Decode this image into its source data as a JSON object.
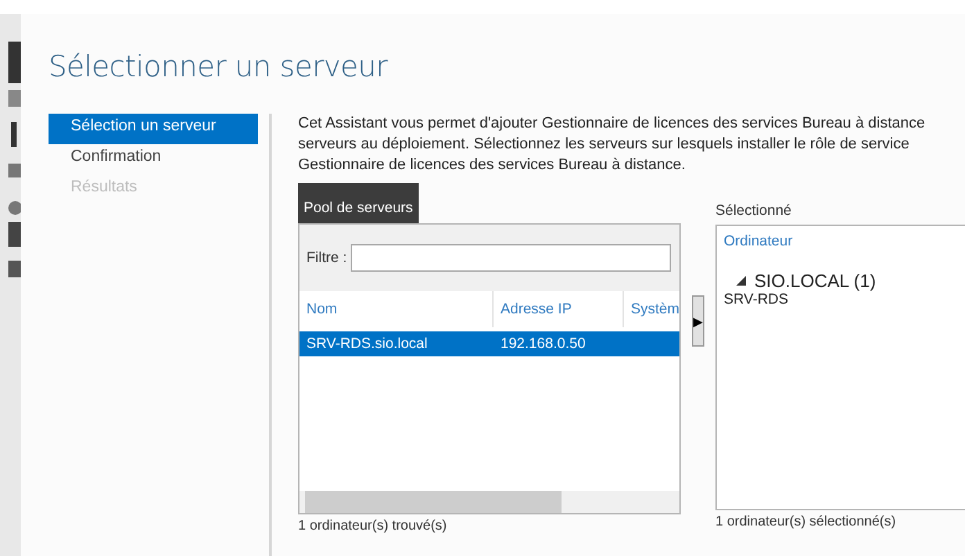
{
  "title": "Sélectionner un serveur",
  "nav": [
    {
      "label": "Sélection un serveur",
      "selected": true,
      "disabled": false
    },
    {
      "label": "Confirmation",
      "selected": false,
      "disabled": false
    },
    {
      "label": "Résultats",
      "selected": false,
      "disabled": true
    }
  ],
  "description": "Cet Assistant vous permet d'ajouter Gestionnaire de licences des services Bureau à distance serveurs au déploiement. Sélectionnez les serveurs sur lesquels installer le rôle de service Gestionnaire de licences des services Bureau à distance.",
  "pool": {
    "tab": "Pool de serveurs",
    "filter_label": "Filtre :",
    "columns": [
      "Nom",
      "Adresse IP",
      "Systèm"
    ],
    "rows": [
      {
        "cells": [
          "SRV-RDS.sio.local",
          "192.168.0.50"
        ],
        "selected": true
      }
    ],
    "footer": "1 ordinateur(s) trouvé(s)"
  },
  "add_button": "▶",
  "selected_panel": {
    "label": "Sélectionné",
    "column": "Ordinateur",
    "groups": [
      {
        "name": "SIO.LOCAL (1)",
        "expanded": true,
        "children": [
          "SRV-RDS"
        ]
      }
    ],
    "footer": "1 ordinateur(s) sélectionné(s)"
  }
}
